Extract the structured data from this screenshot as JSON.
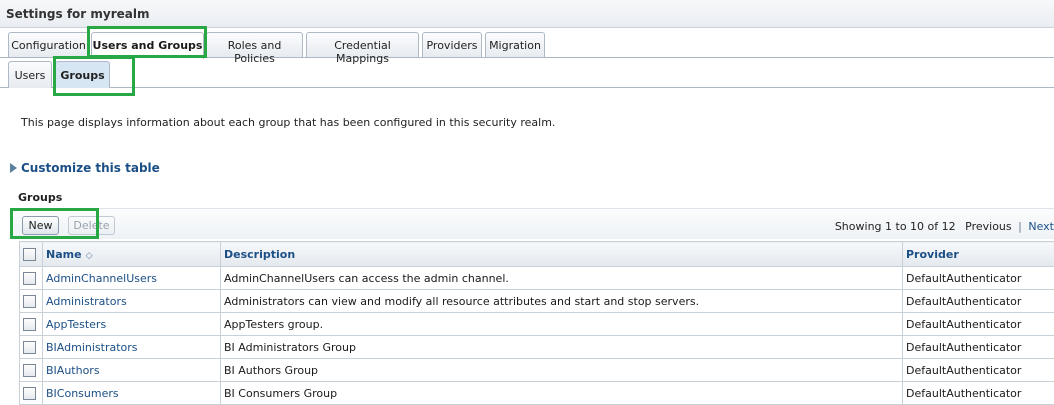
{
  "page": {
    "title": "Settings for myrealm"
  },
  "tabs": [
    {
      "label": "Configuration"
    },
    {
      "label": "Users and Groups",
      "active": true
    },
    {
      "label": "Roles and Policies"
    },
    {
      "label": "Credential Mappings"
    },
    {
      "label": "Providers"
    },
    {
      "label": "Migration"
    }
  ],
  "subtabs": [
    {
      "label": "Users"
    },
    {
      "label": "Groups",
      "active": true
    }
  ],
  "description": "This page displays information about each group that has been configured in this security realm.",
  "customize_label": "Customize this table",
  "groups_heading": "Groups",
  "toolbar": {
    "new_label": "New",
    "delete_label": "Delete",
    "showing": "Showing 1 to 10 of 12",
    "previous_label": "Previous",
    "separator": "|",
    "next_label": "Next"
  },
  "table": {
    "headers": {
      "name": "Name",
      "description": "Description",
      "provider": "Provider"
    },
    "rows": [
      {
        "name": "AdminChannelUsers",
        "description": "AdminChannelUsers can access the admin channel.",
        "provider": "DefaultAuthenticator"
      },
      {
        "name": "Administrators",
        "description": "Administrators can view and modify all resource attributes and start and stop servers.",
        "provider": "DefaultAuthenticator"
      },
      {
        "name": "AppTesters",
        "description": "AppTesters group.",
        "provider": "DefaultAuthenticator"
      },
      {
        "name": "BIAdministrators",
        "description": "BI Administrators Group",
        "provider": "DefaultAuthenticator"
      },
      {
        "name": "BIAuthors",
        "description": "BI Authors Group",
        "provider": "DefaultAuthenticator"
      },
      {
        "name": "BIConsumers",
        "description": "BI Consumers Group",
        "provider": "DefaultAuthenticator"
      }
    ]
  },
  "colors": {
    "highlight": "#27a844",
    "link": "#1b4f86"
  }
}
